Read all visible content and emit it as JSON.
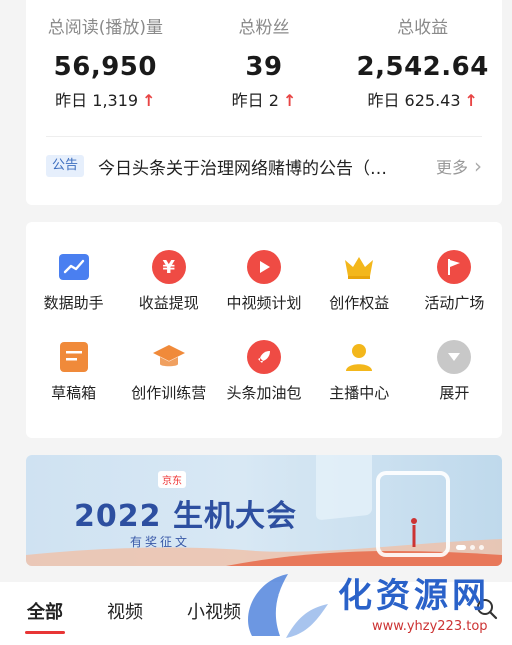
{
  "stats": [
    {
      "label": "总阅读(播放)量",
      "value": "56,950",
      "change": "昨日 1,319",
      "arrow": "↑"
    },
    {
      "label": "总粉丝",
      "value": "39",
      "change": "昨日 2",
      "arrow": "↑"
    },
    {
      "label": "总收益",
      "value": "2,542.64",
      "change": "昨日 625.43",
      "arrow": "↑"
    }
  ],
  "notice": {
    "badge": "公告",
    "text": "今日头条关于治理网络赌博的公告（…",
    "more": "更多"
  },
  "tools": [
    {
      "label": "数据助手",
      "icon": "chart-icon",
      "color": "#4a7ff0"
    },
    {
      "label": "收益提现",
      "icon": "yuan-icon",
      "color": "#ef4b44"
    },
    {
      "label": "中视频计划",
      "icon": "play-icon",
      "color": "#ef4b44"
    },
    {
      "label": "创作权益",
      "icon": "crown-icon",
      "color": "#f3b71b"
    },
    {
      "label": "活动广场",
      "icon": "flag-icon",
      "color": "#ef4b44"
    },
    {
      "label": "草稿箱",
      "icon": "draft-icon",
      "color": "#f08a3a"
    },
    {
      "label": "创作训练营",
      "icon": "graduation-cap-icon",
      "color": "#f08a3a"
    },
    {
      "label": "头条加油包",
      "icon": "rocket-icon",
      "color": "#ef4b44"
    },
    {
      "label": "主播中心",
      "icon": "person-icon",
      "color": "#f3b71b"
    },
    {
      "label": "展开",
      "icon": "chevron-down-icon",
      "color": "#c8c8c8"
    }
  ],
  "banner": {
    "logo": "京东",
    "title": "2022 生机大会",
    "subtitle": "有奖征文"
  },
  "tabs": [
    {
      "label": "全部",
      "active": true
    },
    {
      "label": "视频",
      "active": false
    },
    {
      "label": "小视频",
      "active": false
    }
  ],
  "watermark": {
    "text": "化资源网",
    "url": "www.yhzy223.top"
  }
}
